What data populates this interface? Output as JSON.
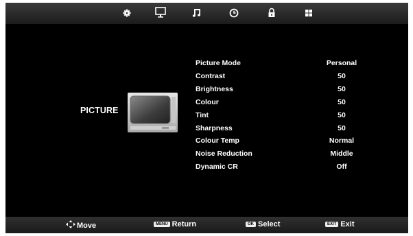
{
  "tabs": [
    {
      "icon": "picture-gear-icon"
    },
    {
      "icon": "monitor-icon"
    },
    {
      "icon": "music-note-icon"
    },
    {
      "icon": "clock-icon"
    },
    {
      "icon": "lock-icon"
    },
    {
      "icon": "grid-icon"
    }
  ],
  "menu": {
    "title": "PICTURE",
    "items": [
      {
        "label": "Picture Mode",
        "value": "Personal"
      },
      {
        "label": "Contrast",
        "value": "50"
      },
      {
        "label": "Brightness",
        "value": "50"
      },
      {
        "label": "Colour",
        "value": "50"
      },
      {
        "label": "Tint",
        "value": "50"
      },
      {
        "label": "Sharpness",
        "value": "50"
      },
      {
        "label": "Colour Temp",
        "value": "Normal"
      },
      {
        "label": "Noise Reduction",
        "value": "Middle"
      },
      {
        "label": "Dynamic CR",
        "value": "Off"
      }
    ]
  },
  "hints": {
    "move": {
      "label": "Move",
      "icon": "dpad-arrows-icon"
    },
    "return": {
      "key": "MENU",
      "label": "Return"
    },
    "select": {
      "key": "OK",
      "label": "Select"
    },
    "exit": {
      "key": "EXIT",
      "label": "Exit"
    }
  },
  "colors": {
    "background": "#000000",
    "bar": "#2a2a2a",
    "text": "#ffffff"
  }
}
